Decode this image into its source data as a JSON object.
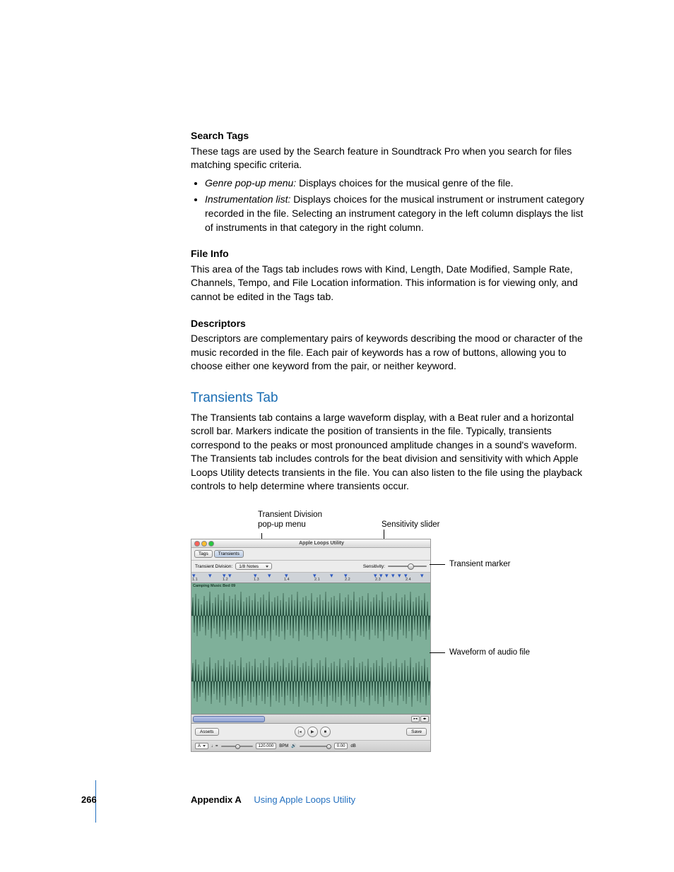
{
  "sections": {
    "search_tags": {
      "heading": "Search Tags",
      "intro": "These tags are used by the Search feature in Soundtrack Pro when you search for files matching specific criteria.",
      "bullet1_term": "Genre pop-up menu:",
      "bullet1_text": "  Displays choices for the musical genre of the file.",
      "bullet2_term": "Instrumentation list:",
      "bullet2_text": "  Displays choices for the musical instrument or instrument category recorded in the file. Selecting an instrument category in the left column displays the list of instruments in that category in the right column."
    },
    "file_info": {
      "heading": "File Info",
      "text": "This area of the Tags tab includes rows with Kind, Length, Date Modified, Sample Rate, Channels, Tempo, and File Location information. This information is for viewing only, and cannot be edited in the Tags tab."
    },
    "descriptors": {
      "heading": "Descriptors",
      "text": "Descriptors are complementary pairs of keywords describing the mood or character of the music recorded in the file. Each pair of keywords has a row of buttons, allowing you to choose either one keyword from the pair, or neither keyword."
    },
    "transients": {
      "heading": "Transients Tab",
      "text": "The Transients tab contains a large waveform display, with a Beat ruler and a horizontal scroll bar. Markers indicate the position of transients in the file. Typically, transients correspond to the peaks or most pronounced amplitude changes in a sound's waveform. The Transients tab includes controls for the beat division and sensitivity with which Apple Loops Utility detects transients in the file. You can also listen to the file using the playback controls to help determine where transients occur."
    }
  },
  "callouts": {
    "transient_division": "Transient Division\npop-up menu",
    "sensitivity_slider": "Sensitivity slider",
    "transient_marker": "Transient marker",
    "waveform": "Waveform of audio file"
  },
  "screenshot": {
    "app_title": "Apple Loops Utility",
    "tabs": {
      "tags": "Tags",
      "transients": "Transients"
    },
    "controls": {
      "transient_division_label": "Transient Division:",
      "transient_division_value": "1/8 Notes",
      "sensitivity_label": "Sensitivity:"
    },
    "ruler_ticks": [
      "1.1",
      "1.2",
      "1.3",
      "1.4",
      "2.1",
      "2.2",
      "2.3",
      "2.4"
    ],
    "track_name": "Camping Music Bed 09",
    "buttons": {
      "assets": "Assets",
      "save": "Save"
    },
    "bottom": {
      "key": "A",
      "tempo_value": "120.000",
      "tempo_unit": "BPM",
      "db_value": "0.00",
      "db_unit": "dB"
    }
  },
  "footer": {
    "page": "266",
    "appendix": "Appendix A",
    "title": "Using Apple Loops Utility"
  }
}
